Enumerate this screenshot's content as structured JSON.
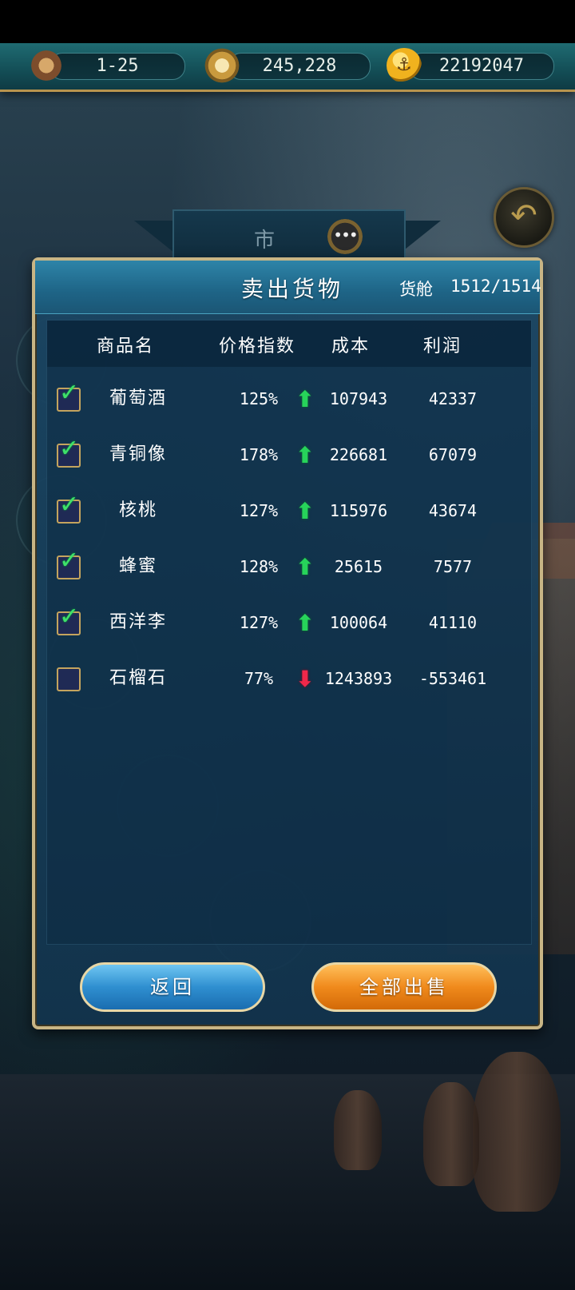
{
  "topbar": {
    "date": "1-25",
    "compass_value": "245,228",
    "gold": "22192047",
    "icons": [
      "hourglass-icon",
      "compass-icon",
      "anchor-coin-icon"
    ]
  },
  "market": {
    "title": "市 场"
  },
  "panel": {
    "title": "卖出货物",
    "hold_label": "货舱",
    "hold_value": "1512/1514"
  },
  "table": {
    "headers": [
      "商品名",
      "价格指数",
      "成本",
      "利润"
    ],
    "rows": [
      {
        "checked": true,
        "name": "葡萄酒",
        "price_index": "125%",
        "trend": "up",
        "cost": "107943",
        "profit": "42337"
      },
      {
        "checked": true,
        "name": "青铜像",
        "price_index": "178%",
        "trend": "up",
        "cost": "226681",
        "profit": "67079"
      },
      {
        "checked": true,
        "name": "核桃",
        "price_index": "127%",
        "trend": "up",
        "cost": "115976",
        "profit": "43674"
      },
      {
        "checked": true,
        "name": "蜂蜜",
        "price_index": "128%",
        "trend": "up",
        "cost": "25615",
        "profit": "7577"
      },
      {
        "checked": true,
        "name": "西洋李",
        "price_index": "127%",
        "trend": "up",
        "cost": "100064",
        "profit": "41110"
      },
      {
        "checked": false,
        "name": "石榴石",
        "price_index": "77%",
        "trend": "down",
        "cost": "1243893",
        "profit": "-553461"
      }
    ]
  },
  "buttons": {
    "back": "返回",
    "sell_all": "全部出售"
  },
  "colors": {
    "trend_up": "#27d35a",
    "trend_down": "#f0284a",
    "sell_button": "#f08a1c",
    "back_button": "#2f8fd0"
  }
}
